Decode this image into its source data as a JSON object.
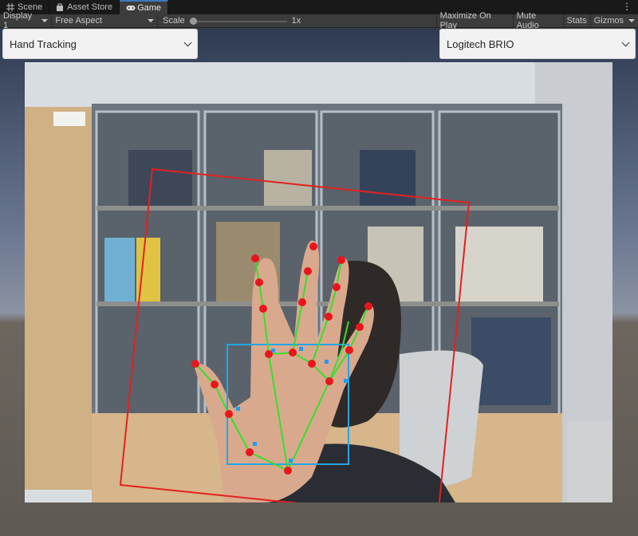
{
  "tabs": [
    {
      "label": "Scene",
      "icon": "grid-icon",
      "active": false
    },
    {
      "label": "Asset Store",
      "icon": "bag-icon",
      "active": false
    },
    {
      "label": "Game",
      "icon": "gamepad-icon",
      "active": true
    }
  ],
  "toolbar": {
    "display": "Display 1",
    "aspect": "Free Aspect",
    "scale_label": "Scale",
    "scale_value": "1x",
    "maximize": "Maximize On Play",
    "mute": "Mute Audio",
    "stats": "Stats",
    "gizmos": "Gizmos"
  },
  "overlay": {
    "mode_dropdown": "Hand Tracking",
    "camera_dropdown": "Logitech BRIO"
  },
  "colors": {
    "roi_box": "#e5201f",
    "palm_box": "#21a6e6",
    "skeleton": "#35e02c",
    "landmark": "#e8161b",
    "keypoint": "#1f9cf0"
  }
}
